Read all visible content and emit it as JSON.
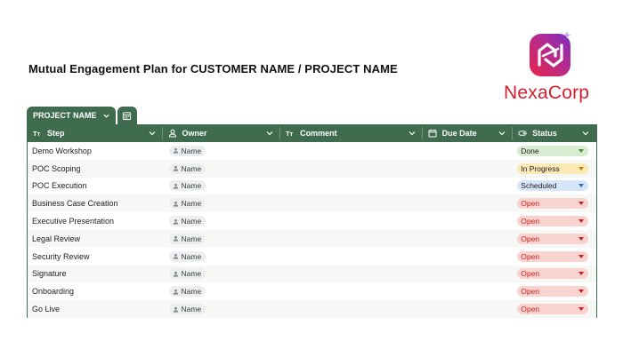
{
  "page": {
    "title": "Mutual Engagement Plan for CUSTOMER NAME / PROJECT NAME"
  },
  "logo": {
    "text": "NexaCorp",
    "icon": "nexacorp-logo-icon",
    "text_color": "#d4202f"
  },
  "tabs": {
    "active_label": "PROJECT NAME",
    "calendar_icon": "calendar-view-icon"
  },
  "colors": {
    "header_bg": "#3f6b4e",
    "done_bg": "#d7ecd0",
    "done_arrow": "#4a8a3a",
    "in_progress_bg": "#fbe9b6",
    "in_progress_arrow": "#b8860b",
    "scheduled_bg": "#d6e6f8",
    "scheduled_arrow": "#2f6fbf",
    "open_bg": "#f9d3d0",
    "open_text": "#c5221f",
    "open_arrow": "#c5221f"
  },
  "columns": [
    {
      "label": "Step",
      "icon": "text-type-icon"
    },
    {
      "label": "Owner",
      "icon": "person-icon"
    },
    {
      "label": "Comment",
      "icon": "text-type-icon"
    },
    {
      "label": "Due Date",
      "icon": "calendar-icon"
    },
    {
      "label": "Status",
      "icon": "status-toggle-icon"
    }
  ],
  "rows": [
    {
      "step": "Demo Workshop",
      "owner": "Name",
      "comment": "",
      "due": "",
      "status": "Done",
      "status_kind": "done"
    },
    {
      "step": "POC Scoping",
      "owner": "Name",
      "comment": "",
      "due": "",
      "status": "In Progress",
      "status_kind": "in_progress"
    },
    {
      "step": "POC Execution",
      "owner": "Name",
      "comment": "",
      "due": "",
      "status": "Scheduled",
      "status_kind": "scheduled"
    },
    {
      "step": "Business Case Creation",
      "owner": "Name",
      "comment": "",
      "due": "",
      "status": "Open",
      "status_kind": "open"
    },
    {
      "step": "Executive Presentation",
      "owner": "Name",
      "comment": "",
      "due": "",
      "status": "Open",
      "status_kind": "open"
    },
    {
      "step": "Legal Review",
      "owner": "Name",
      "comment": "",
      "due": "",
      "status": "Open",
      "status_kind": "open"
    },
    {
      "step": "Security Review",
      "owner": "Name",
      "comment": "",
      "due": "",
      "status": "Open",
      "status_kind": "open"
    },
    {
      "step": "Signature",
      "owner": "Name",
      "comment": "",
      "due": "",
      "status": "Open",
      "status_kind": "open"
    },
    {
      "step": "Onboarding",
      "owner": "Name",
      "comment": "",
      "due": "",
      "status": "Open",
      "status_kind": "open"
    },
    {
      "step": "Go Live",
      "owner": "Name",
      "comment": "",
      "due": "",
      "status": "Open",
      "status_kind": "open"
    }
  ]
}
